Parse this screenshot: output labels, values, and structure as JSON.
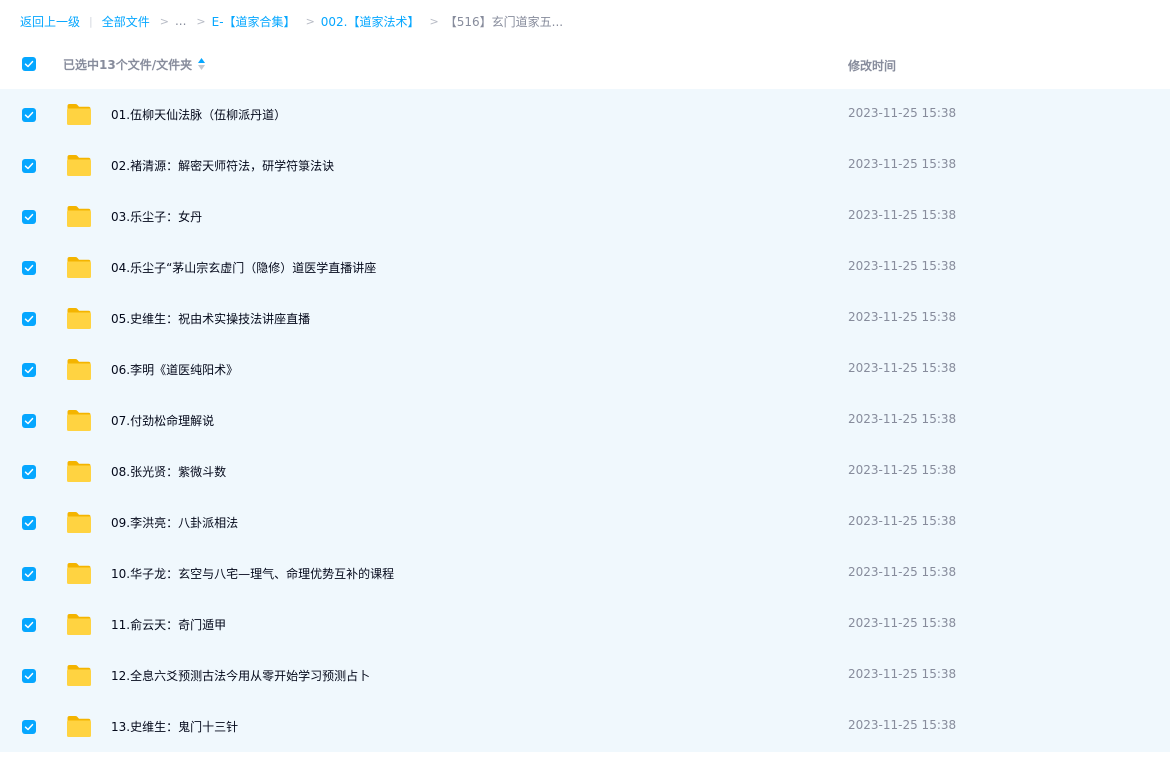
{
  "breadcrumb": {
    "back": "返回上一级",
    "all_files": "全部文件",
    "ellipsis": "...",
    "level1": "E-【道家合集】",
    "level2": "002.【道家法术】",
    "current": "【516】玄门道家五..."
  },
  "header": {
    "selected_label": "已选中13个文件/文件夹",
    "modified_time_label": "修改时间",
    "all_checked": true
  },
  "accent_color": "#06a7ff",
  "row_selected_bg": "#f0f8fd",
  "files": [
    {
      "name": "01.伍柳天仙法脉（伍柳派丹道）",
      "time": "2023-11-25 15:38",
      "type": "folder",
      "checked": true
    },
    {
      "name": "02.褚清源：解密天师符法，研学符箓法诀",
      "time": "2023-11-25 15:38",
      "type": "folder",
      "checked": true
    },
    {
      "name": "03.乐尘子：女丹",
      "time": "2023-11-25 15:38",
      "type": "folder",
      "checked": true
    },
    {
      "name": "04.乐尘子“茅山宗玄虚门（隐修）道医学直播讲座",
      "time": "2023-11-25 15:38",
      "type": "folder",
      "checked": true
    },
    {
      "name": "05.史维生：祝由术实操技法讲座直播",
      "time": "2023-11-25 15:38",
      "type": "folder",
      "checked": true
    },
    {
      "name": "06.李明《道医纯阳术》",
      "time": "2023-11-25 15:38",
      "type": "folder",
      "checked": true
    },
    {
      "name": "07.付劲松命理解说",
      "time": "2023-11-25 15:38",
      "type": "folder",
      "checked": true
    },
    {
      "name": "08.张光贤：紫微斗数",
      "time": "2023-11-25 15:38",
      "type": "folder",
      "checked": true
    },
    {
      "name": "09.李洪亮：八卦派相法",
      "time": "2023-11-25 15:38",
      "type": "folder",
      "checked": true
    },
    {
      "name": "10.华子龙：玄空与八宅—理气、命理优势互补的课程",
      "time": "2023-11-25 15:38",
      "type": "folder",
      "checked": true
    },
    {
      "name": "11.俞云天：奇门遁甲",
      "time": "2023-11-25 15:38",
      "type": "folder",
      "checked": true
    },
    {
      "name": "12.全息六爻预测古法今用从零开始学习预测占卜",
      "time": "2023-11-25 15:38",
      "type": "folder",
      "checked": true
    },
    {
      "name": "13.史维生：鬼门十三针",
      "time": "2023-11-25 15:38",
      "type": "folder",
      "checked": true
    }
  ]
}
